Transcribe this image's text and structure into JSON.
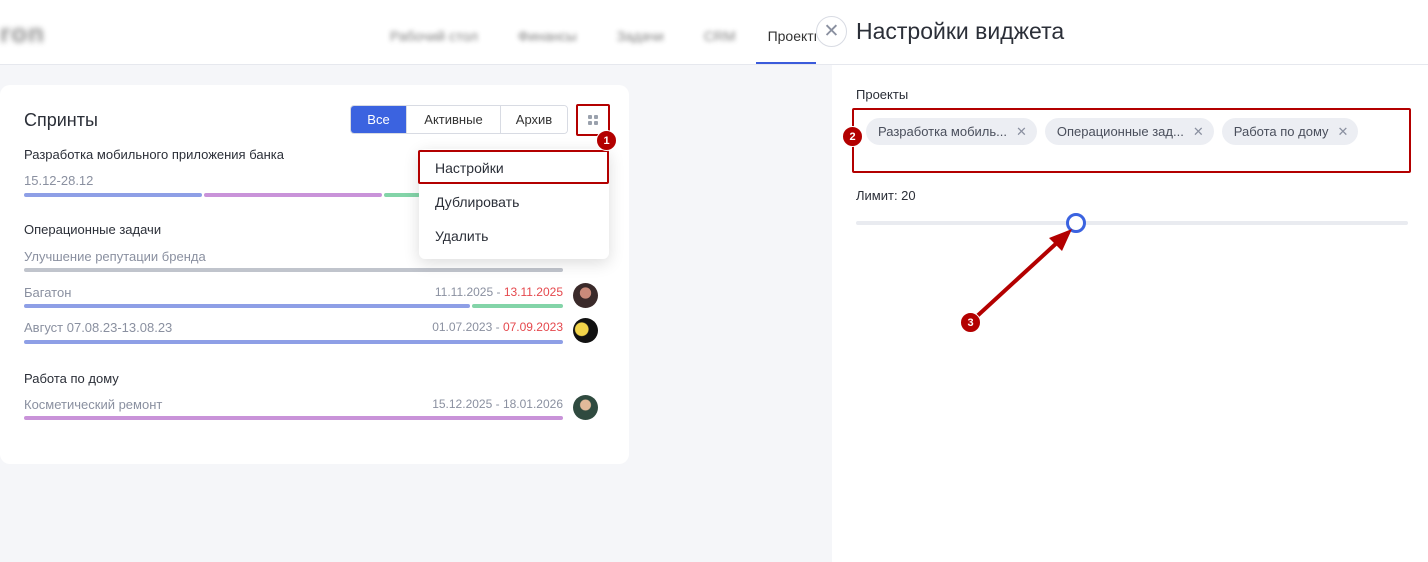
{
  "topbar": {
    "logo": "ron",
    "nav": [
      "Рабочий стол",
      "Финансы",
      "Задачи",
      "CRM",
      "Проекты"
    ]
  },
  "widget": {
    "title": "Спринты",
    "filters": [
      "Все",
      "Активные",
      "Архив"
    ],
    "active_filter": "Все",
    "projects": [
      {
        "name": "Разработка мобильного приложения банка",
        "sprints": [
          {
            "name": "15.12-28.12",
            "date_start": "",
            "date_end": "",
            "bar": [
              "#8e9fe6",
              "#c993d9",
              "#83d4a8"
            ]
          }
        ]
      },
      {
        "name": "Операционные задачи",
        "sprints": [
          {
            "name": "Улучшение репутации бренда",
            "date_start": "",
            "date_end": "",
            "bar": [
              "#c0c4cc"
            ]
          },
          {
            "name": "Багатон",
            "date_start": "11.11.2025",
            "date_end": "13.11.2025",
            "bar": [
              "#8e9fe6",
              "#83d4a8"
            ]
          },
          {
            "name": "Август 07.08.23-13.08.23",
            "date_start": "01.07.2023",
            "date_end": "07.09.2023",
            "bar": [
              "#8e9fe6"
            ]
          }
        ]
      },
      {
        "name": "Работа по дому",
        "sprints": [
          {
            "name": "Косметический ремонт",
            "date_start": "15.12.2025",
            "date_end": "18.01.2026",
            "bar": [
              "#c993d9"
            ]
          }
        ]
      }
    ],
    "date_separator": " - "
  },
  "menu": {
    "items": [
      "Настройки",
      "Дублировать",
      "Удалить"
    ]
  },
  "panel": {
    "title": "Настройки виджета",
    "projects_label": "Проекты",
    "tags": [
      "Разработка мобиль...",
      "Операционные зад...",
      "Работа по дому"
    ],
    "limit_label": "Лимит: 20",
    "limit_value": 20
  },
  "badges": [
    "1",
    "2",
    "3"
  ],
  "colors": {
    "accent": "#3b63e0",
    "annotation": "#b30000",
    "late_date": "#e5484d"
  }
}
